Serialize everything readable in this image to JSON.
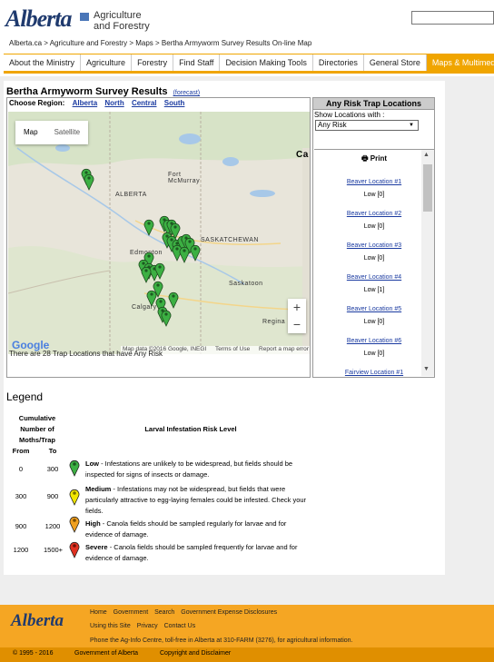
{
  "header": {
    "logo_word": "Alberta",
    "logo_line1": "Agriculture",
    "logo_line2": "and Forestry"
  },
  "breadcrumb": {
    "items": [
      "Alberta.ca",
      "Agriculture and Forestry",
      "Maps",
      "Bertha Armyworm Survey Results On-line Map"
    ],
    "separator": " > "
  },
  "nav": {
    "items": [
      "About the Ministry",
      "Agriculture",
      "Forestry",
      "Find Staff",
      "Decision Making Tools",
      "Directories",
      "General Store",
      "Maps & Multimedia"
    ],
    "active": "Maps & Multimedia"
  },
  "page": {
    "title": "Bertha Armyworm Survey Results",
    "forecast_link": "(forecast)"
  },
  "regions": {
    "label": "Choose Region:",
    "items": [
      "Alberta",
      "North",
      "Central",
      "South"
    ]
  },
  "map": {
    "tabs": [
      "Map",
      "Satellite"
    ],
    "zoom_in": "+",
    "zoom_out": "−",
    "google": "Google",
    "attribution": [
      "Map data ©2016 Google, INEGI",
      "Terms of Use",
      "Report a map error"
    ],
    "places": [
      "ALBERTA",
      "Fort McMurray",
      "SASKATCHEWAN",
      "Edmonton",
      "Saskatoon",
      "Calgary",
      "Regina",
      "Ca"
    ],
    "marker_color": "#3cb043",
    "trap_count_text": "There are 28 Trap Locations that have Any Risk"
  },
  "risk_panel": {
    "title": "Any Risk Trap Locations",
    "show_label": "Show Locations with :",
    "selected": "Any Risk",
    "print_label": "Print",
    "locations": [
      {
        "name": "Beaver Location #1",
        "risk": "Low [0]"
      },
      {
        "name": "Beaver Location #2",
        "risk": "Low [0]"
      },
      {
        "name": "Beaver Location #3",
        "risk": "Low [0]"
      },
      {
        "name": "Beaver Location #4",
        "risk": "Low [1]"
      },
      {
        "name": "Beaver Location #5",
        "risk": "Low [0]"
      },
      {
        "name": "Beaver Location #6",
        "risk": "Low [0]"
      },
      {
        "name": "Fairview Location #1",
        "risk": ""
      }
    ]
  },
  "legend": {
    "title": "Legend",
    "col_cumulative": [
      "Cumulative",
      "Number of",
      "Moths/Trap"
    ],
    "col_from": "From",
    "col_to": "To",
    "col_level": "Larval Infestation Risk Level",
    "rows": [
      {
        "from": "0",
        "to": "300",
        "level": "Low",
        "color": "#3cb043",
        "desc": " - Infestations are unlikely to be widespread, but fields should be inspected for signs of insects or damage."
      },
      {
        "from": "300",
        "to": "900",
        "level": "Medium",
        "color": "#f2e600",
        "desc": " - Infestations may not be widespread, but fields that were particularly attractive to egg-laying females could be infested. Check your fields."
      },
      {
        "from": "900",
        "to": "1200",
        "level": "High",
        "color": "#f0a020",
        "desc": " - Canola fields should be sampled regularly for larvae and for evidence of damage."
      },
      {
        "from": "1200",
        "to": "1500+",
        "level": "Severe",
        "color": "#e03020",
        "desc": " - Canola fields should be sampled frequently for larvae and for evidence of damage."
      }
    ]
  },
  "footer": {
    "logo": "Alberta",
    "links1": [
      "Home",
      "Government",
      "Search",
      "Government Expense Disclosures"
    ],
    "links2": [
      "Using this Site",
      "Privacy",
      "Contact Us"
    ],
    "phone": "Phone the Ag-Info Centre, toll-free in Alberta at 310-FARM (3276), for agricultural information.",
    "copyright": "© 1995 - 2016",
    "gov": "Government of Alberta",
    "disclaimer": "Copyright and Disclaimer"
  }
}
